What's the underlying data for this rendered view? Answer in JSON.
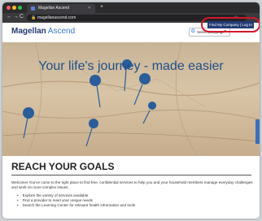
{
  "browser": {
    "tab_title": "Magellan Ascend",
    "tab_close": "×",
    "new_tab": "+",
    "url": "magellanascend.com",
    "nav_back": "←",
    "nav_forward": "→",
    "nav_reload": "C",
    "lock_icon": "🔒",
    "bookmark_icon": "☆"
  },
  "header": {
    "logo_primary": "Magellan",
    "logo_secondary": "Ascend",
    "language_icon": "G",
    "language_label": "Select Language",
    "language_caret": "▼",
    "login_label": "Find My Company | Log In"
  },
  "hero": {
    "title": "Your life's journey - made easier"
  },
  "main": {
    "heading": "REACH YOUR GOALS",
    "intro": "Welcome! You've come to the right place to find free, confidential services to help you and your household members manage everyday challenges and work on more complex issues.",
    "bullets": [
      "Explore the variety of services available",
      "Find a provider to meet your unique needs",
      "Search the Learning Center for relevant health information and tools"
    ]
  },
  "colors": {
    "brand_navy": "#233a73",
    "brand_blue": "#3a79c6",
    "highlight_ring": "#d4162c",
    "pin_blue": "#2a5d9a"
  }
}
